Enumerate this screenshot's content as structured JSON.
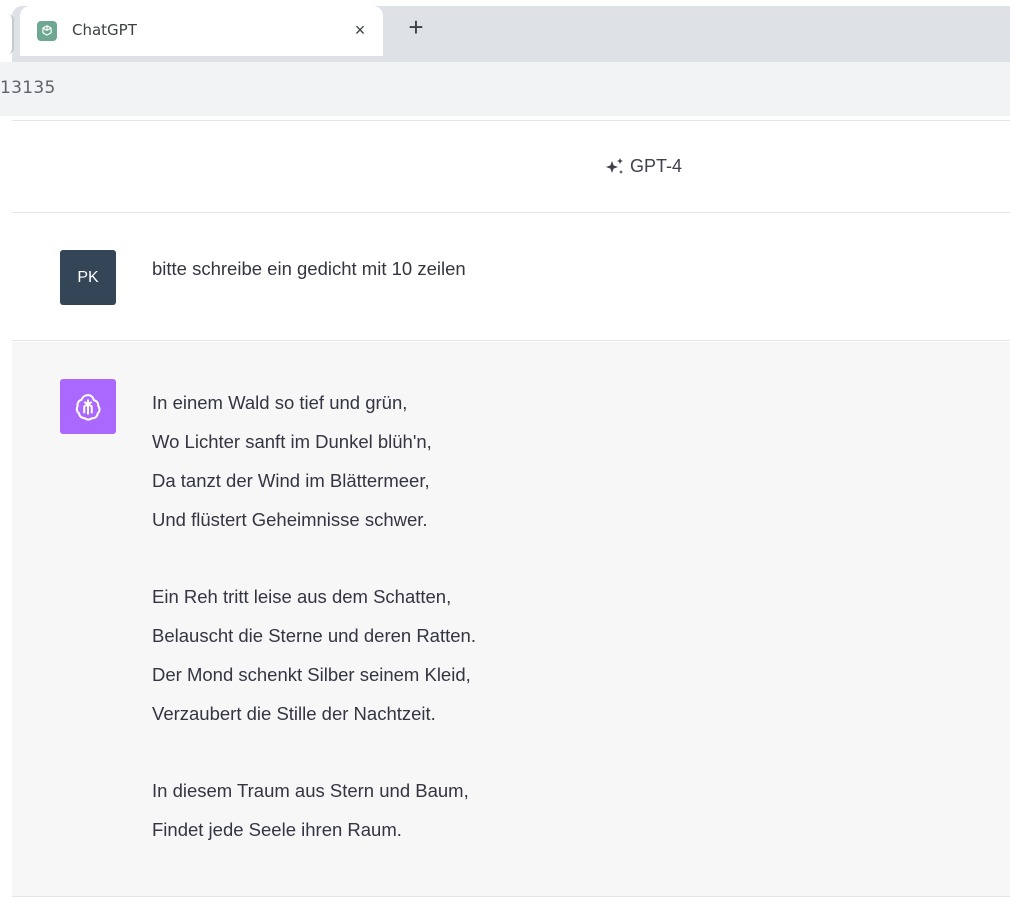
{
  "browser": {
    "tab_title": "ChatGPT",
    "tab_close": "×",
    "new_tab": "+",
    "address_text": "13135"
  },
  "header": {
    "model_label": "GPT-4"
  },
  "conversation": {
    "user": {
      "avatar_initials": "PK",
      "message": "bitte schreibe ein gedicht mit 10 zeilen"
    },
    "assistant": {
      "stanzas": [
        [
          "In einem Wald so tief und grün,",
          "Wo Lichter sanft im Dunkel blüh'n,",
          "Da tanzt der Wind im Blättermeer,",
          "Und flüstert Geheimnisse schwer."
        ],
        [
          "Ein Reh tritt leise aus dem Schatten,",
          "Belauscht die Sterne und deren Ratten.",
          "Der Mond schenkt Silber seinem Kleid,",
          "Verzaubert die Stille der Nachtzeit."
        ],
        [
          "In diesem Traum aus Stern und Baum,",
          "Findet jede Seele ihren Raum."
        ]
      ]
    }
  },
  "colors": {
    "user_avatar": "#334556",
    "assistant_avatar": "#ab68ff",
    "assistant_bg": "#f7f7f8"
  },
  "icons": {
    "favicon": "openai-logo-icon",
    "assistant_avatar": "openai-logo-icon",
    "model": "sparkle-icon"
  }
}
